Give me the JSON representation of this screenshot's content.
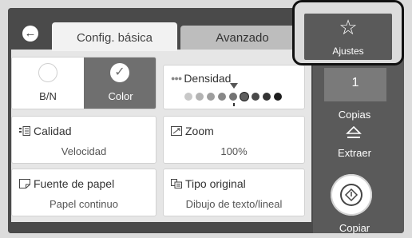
{
  "header": {
    "tabs": [
      {
        "label": "Config. básica",
        "active": true
      },
      {
        "label": "Avanzado",
        "active": false
      }
    ]
  },
  "color_mode": {
    "options": [
      {
        "label": "B/N",
        "selected": false
      },
      {
        "label": "Color",
        "selected": true
      }
    ]
  },
  "density": {
    "title": "Densidad",
    "levels": 9,
    "current_level": 6
  },
  "quality": {
    "title": "Calidad",
    "value": "Velocidad"
  },
  "zoom": {
    "title": "Zoom",
    "value": "100%"
  },
  "paper_source": {
    "title": "Fuente de papel",
    "value": "Papel continuo"
  },
  "original_type": {
    "title": "Tipo original",
    "value": "Dibujo de texto/lineal"
  },
  "sidebar": {
    "settings_label": "Ajustes",
    "copies_value": "1",
    "copies_label": "Copias",
    "eject_label": "Extraer",
    "copy_label": "Copiar"
  },
  "colors": {
    "background": "#4a4a4a",
    "panel": "#e6e6e6",
    "accent_selected": "#6f6f6f",
    "highlight_border": "#111111"
  }
}
